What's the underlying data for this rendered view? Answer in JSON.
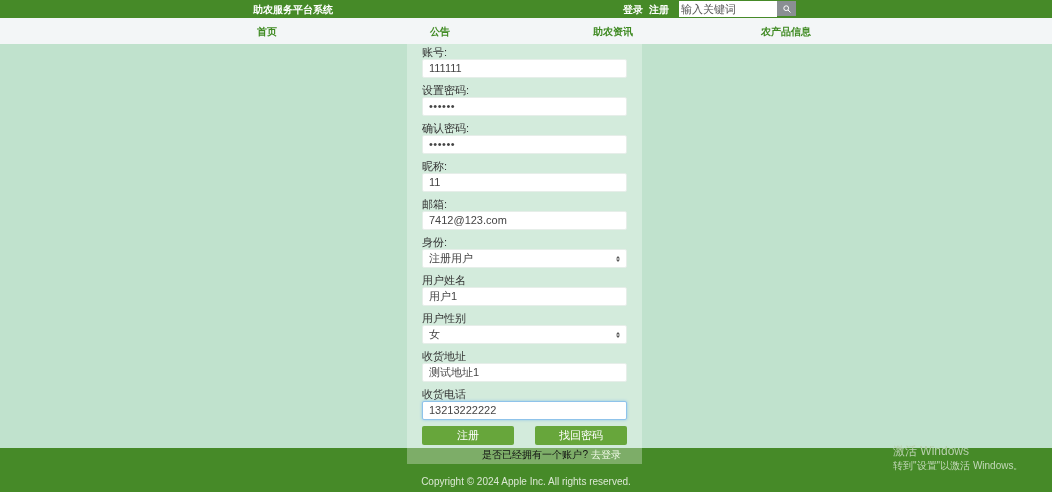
{
  "header": {
    "title": "助农服务平台系统",
    "links": [
      "登录",
      "注册"
    ],
    "search": {
      "placeholder": "输入关键词"
    }
  },
  "nav": [
    "首页",
    "公告",
    "助农资讯",
    "农产品信息"
  ],
  "form": {
    "fields": [
      {
        "label": "账号:",
        "kind": "input",
        "value": "111111",
        "focused": false
      },
      {
        "label": "设置密码:",
        "kind": "password",
        "value": "••••••",
        "focused": false
      },
      {
        "label": "确认密码:",
        "kind": "password",
        "value": "••••••",
        "focused": false
      },
      {
        "label": "昵称:",
        "kind": "input",
        "value": "11",
        "focused": false
      },
      {
        "label": "邮箱:",
        "kind": "input",
        "value": "7412@123.com",
        "focused": false
      },
      {
        "label": "身份:",
        "kind": "select",
        "value": "注册用户",
        "focused": false
      },
      {
        "label": "用户姓名",
        "kind": "input",
        "value": "用户1",
        "focused": false
      },
      {
        "label": "用户性别",
        "kind": "select",
        "value": "女",
        "focused": false
      },
      {
        "label": "收货地址",
        "kind": "input",
        "value": "测试地址1",
        "focused": false
      },
      {
        "label": "收货电话",
        "kind": "input",
        "value": "13213222222",
        "focused": true
      }
    ],
    "buttons": [
      "注册",
      "找回密码"
    ],
    "login_prompt": {
      "text": "是否已经拥有一个账户?",
      "link": "去登录"
    }
  },
  "footer": {
    "copyright": "Copyright © 2024 Apple Inc. All rights reserved."
  },
  "activation_notice": {
    "title": "激活 Windows",
    "subtitle": "转到\"设置\"以激活 Windows。"
  }
}
